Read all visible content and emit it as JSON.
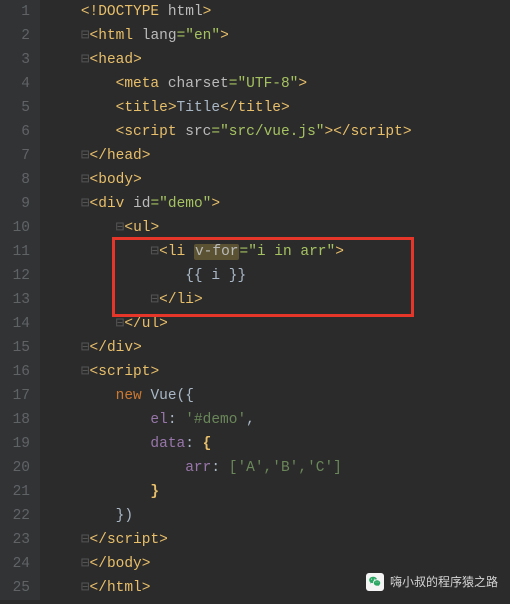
{
  "gutter": [
    "1",
    "2",
    "3",
    "4",
    "5",
    "6",
    "7",
    "8",
    "9",
    "10",
    "11",
    "12",
    "13",
    "14",
    "15",
    "16",
    "17",
    "18",
    "19",
    "20",
    "21",
    "22",
    "23",
    "24",
    "25"
  ],
  "code": {
    "l1": {
      "open": "<",
      "tag": "!DOCTYPE ",
      "attr": "html",
      "close": ">"
    },
    "l2": {
      "open": "<",
      "tag": "html ",
      "attr": "lang",
      "eq": "=",
      "val": "\"en\"",
      "close": ">"
    },
    "l3": {
      "open": "<",
      "tag": "head",
      "close": ">"
    },
    "l4": {
      "open": "<",
      "tag": "meta ",
      "attr": "charset",
      "eq": "=",
      "val": "\"UTF-8\"",
      "close": ">"
    },
    "l5": {
      "open": "<",
      "tag": "title",
      "close": ">",
      "text": "Title",
      "open2": "</",
      "tag2": "title",
      "close2": ">"
    },
    "l6": {
      "open": "<",
      "tag": "script ",
      "attr": "src",
      "eq": "=",
      "val": "\"src/vue.js\"",
      "close": ">",
      "open2": "</",
      "tag2": "script",
      "close2": ">"
    },
    "l7": {
      "open": "</",
      "tag": "head",
      "close": ">"
    },
    "l8": {
      "open": "<",
      "tag": "body",
      "close": ">"
    },
    "l9": {
      "open": "<",
      "tag": "div ",
      "attr": "id",
      "eq": "=",
      "val": "\"demo\"",
      "close": ">"
    },
    "l10": {
      "open": "<",
      "tag": "ul",
      "close": ">"
    },
    "l11": {
      "open": "<",
      "tag": "li ",
      "attr": "v-for",
      "eq": "=",
      "val": "\"i in arr\"",
      "close": ">"
    },
    "l12": {
      "text": "{{ i }}"
    },
    "l13": {
      "open": "</",
      "tag": "li",
      "close": ">"
    },
    "l14": {
      "open": "</",
      "tag": "ul",
      "close": ">"
    },
    "l15": {
      "open": "</",
      "tag": "div",
      "close": ">"
    },
    "l16": {
      "open": "<",
      "tag": "script",
      "close": ">"
    },
    "l17": {
      "kw": "new ",
      "cls": "Vue",
      "paren": "({"
    },
    "l18": {
      "prop": "el",
      "colon": ": ",
      "val": "'#demo'",
      "comma": ","
    },
    "l19": {
      "prop": "data",
      "colon": ": ",
      "brace": "{"
    },
    "l20": {
      "prop": "arr",
      "colon": ": ",
      "arr": "['A','B','C']"
    },
    "l21": {
      "brace": "}"
    },
    "l22": {
      "close": "})"
    },
    "l23": {
      "open": "</",
      "tag": "script",
      "close": ">"
    },
    "l24": {
      "open": "</",
      "tag": "body",
      "close": ">"
    },
    "l25": {
      "open": "</",
      "tag": "html",
      "close": ">"
    }
  },
  "indent": {
    "i1": "    ",
    "i2": "        ",
    "i3": "            ",
    "i4": "                ",
    "i5": "                    "
  },
  "watermark": {
    "text": "嗨小叔的程序猿之路"
  }
}
